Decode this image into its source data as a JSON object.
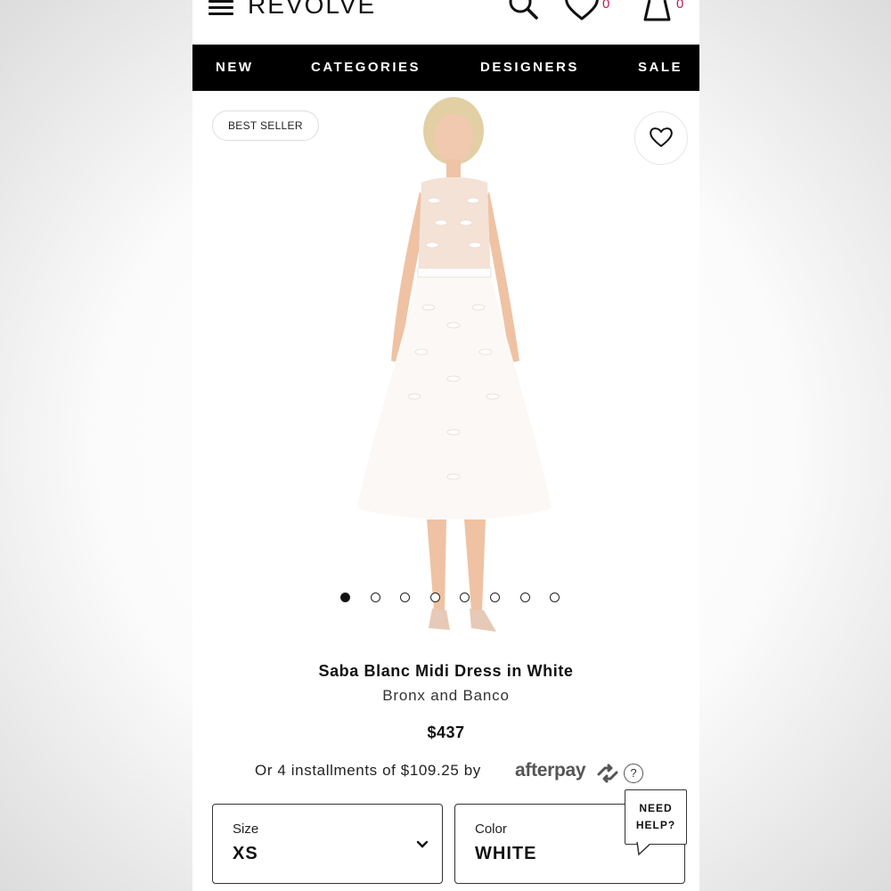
{
  "header": {
    "logo": "REVOLVE",
    "wishlist_count": "0",
    "bag_count": "0"
  },
  "nav": {
    "items": [
      {
        "label": "NEW"
      },
      {
        "label": "CATEGORIES"
      },
      {
        "label": "DESIGNERS"
      },
      {
        "label": "SALE"
      }
    ]
  },
  "product": {
    "badge": "BEST SELLER",
    "title": "Saba Blanc Midi Dress in White",
    "brand": "Bronx and Banco",
    "price": "$437",
    "installments_text": "Or 4 installments of $109.25 by",
    "afterpay_label": "afterpay",
    "help_symbol": "?",
    "image_count": 8,
    "active_image_index": 0
  },
  "options": {
    "size": {
      "label": "Size",
      "value": "XS"
    },
    "color": {
      "label": "Color",
      "value": "WHITE"
    }
  },
  "help_bubble": {
    "line1": "NEED",
    "line2": "HELP?"
  },
  "colors": {
    "nav_bg": "#000000",
    "count_accent": "#c2185b",
    "page_bg": "#ffffff"
  },
  "icons": [
    "menu-icon",
    "search-icon",
    "heart-icon",
    "bag-icon",
    "chevron-down-icon",
    "afterpay-arrows-icon",
    "question-icon"
  ]
}
